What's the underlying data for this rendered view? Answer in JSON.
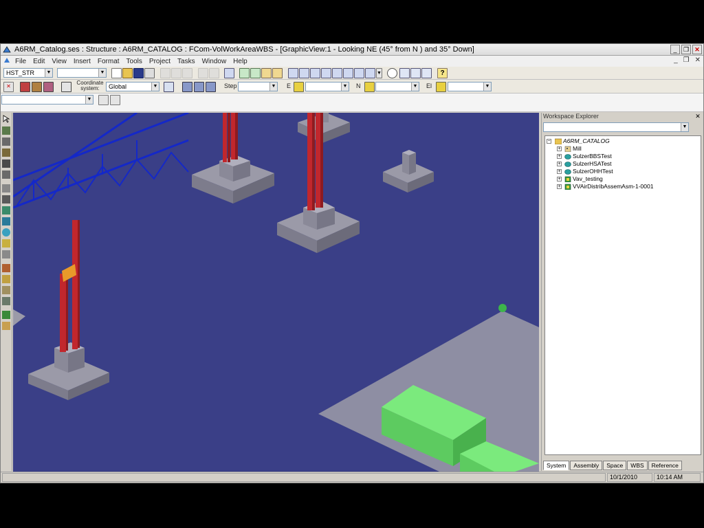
{
  "window": {
    "title": "A6RM_Catalog.ses : Structure : A6RM_CATALOG : FCom-VolWorkAreaWBS - [GraphicView:1 - Looking NE (45° from N ) and 35° Down]"
  },
  "menu": [
    "File",
    "Edit",
    "View",
    "Insert",
    "Format",
    "Tools",
    "Project",
    "Tasks",
    "Window",
    "Help"
  ],
  "toolbar1": {
    "task_combo": "HST_STR",
    "second_combo": ""
  },
  "toolbar2": {
    "coordinate_label": "Coordinate system:",
    "coordinate_value": "Global",
    "step_label": "Step",
    "e_label": "E",
    "n_label": "N",
    "el_label": "El"
  },
  "toolbar3": {
    "locate_combo": ""
  },
  "explorer": {
    "title": "Workspace Explorer",
    "filter": "",
    "root": "A6RM_CATALOG",
    "items": [
      {
        "label": "Mill",
        "icon": "building-icon"
      },
      {
        "label": "SulzerBBSTest",
        "icon": "system-icon"
      },
      {
        "label": "SulzerHSATest",
        "icon": "system-icon"
      },
      {
        "label": "SulzerOHHTest",
        "icon": "system-icon"
      },
      {
        "label": "Vav_testing",
        "icon": "assembly-icon"
      },
      {
        "label": "VVAirDistribAssemAsm-1-0001",
        "icon": "assembly-icon"
      }
    ],
    "tabs": [
      "System",
      "Assembly",
      "Space",
      "WBS",
      "Reference"
    ],
    "active_tab": "System"
  },
  "status": {
    "date": "10/1/2010",
    "time": "10:14 AM"
  },
  "colors": {
    "viewport_bg": "#3a3f87",
    "column": "#c1272d",
    "truss": "#1428c8",
    "footing": "#9b9aa8",
    "equipment": "#66d36a"
  }
}
